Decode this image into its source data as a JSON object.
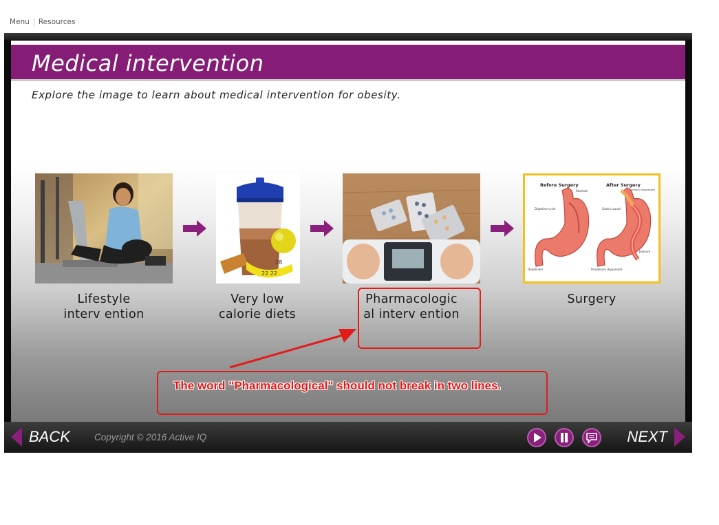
{
  "topmenu": {
    "menu": "Menu",
    "resources": "Resources"
  },
  "slide": {
    "title": "Medical intervention",
    "subtitle": "Explore the image to learn about medical intervention for obesity."
  },
  "cards": [
    {
      "label_line1": "Lifestyle",
      "label_line2": "interv ention",
      "image": "woman-exercise-bike-photo"
    },
    {
      "label_line1": "Very low",
      "label_line2": "calorie diets",
      "image": "shaker-apple-tape-photo"
    },
    {
      "label_line1": "Pharmacologic",
      "label_line2": "al interv ention",
      "image": "pills-on-scale-photo"
    },
    {
      "label_line1": "Surgery",
      "label_line2": "",
      "image": "stomach-surgery-diagram",
      "diagram_text": {
        "before": "Before Surgery",
        "after": "After Surgery",
        "stomach": "Stomach",
        "digestive_cycle": "Digestive cycle",
        "duodenum": "Duodenum",
        "gastric_pouch": "Gastric pouch",
        "jejunum": "Jejunum",
        "stomach_bypassed": "Stomach (bypassed)",
        "duodenum_bypassed": "Duodenum (bypassed)"
      }
    }
  ],
  "annotation": {
    "note": "The word \"Pharmacological\" should not break in two lines."
  },
  "nav": {
    "back": "BACK",
    "next": "NEXT",
    "copyright": "Copyright © 2016 Active IQ",
    "controls": [
      "play-icon",
      "pause-icon",
      "caption-icon"
    ]
  },
  "colors": {
    "brand_purple": "#851d76",
    "annotation_red": "#e31b1b",
    "surgery_border": "#f2c21b"
  }
}
